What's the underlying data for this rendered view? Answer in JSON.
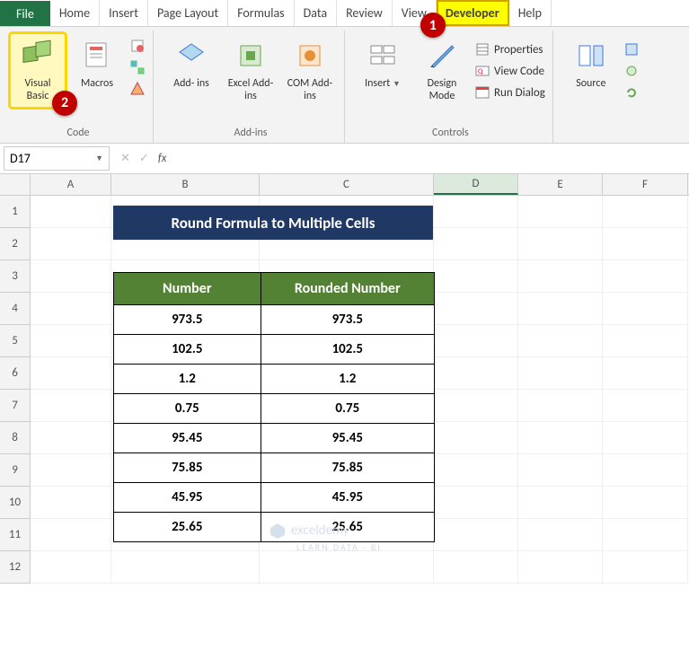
{
  "menu": {
    "file": "File",
    "tabs": [
      "Home",
      "Insert",
      "Page Layout",
      "Formulas",
      "Data",
      "Review",
      "View",
      "Developer",
      "Help"
    ]
  },
  "callouts": {
    "one": "1",
    "two": "2"
  },
  "ribbon": {
    "groups": {
      "code": {
        "label": "Code",
        "visual_basic": "Visual\nBasic",
        "macros": "Macros"
      },
      "addins": {
        "label": "Add-ins",
        "addins": "Add-\nins",
        "excel_addins": "Excel\nAdd-ins",
        "com_addins": "COM\nAdd-ins"
      },
      "controls": {
        "label": "Controls",
        "insert": "Insert",
        "design_mode": "Design\nMode",
        "properties": "Properties",
        "view_code": "View Code",
        "run_dialog": "Run Dialog"
      },
      "xml": {
        "source": "Source"
      }
    }
  },
  "formula_bar": {
    "name_box": "D17",
    "cancel": "✕",
    "confirm": "✓",
    "fx": "fx",
    "value": ""
  },
  "sheet": {
    "columns": [
      "A",
      "B",
      "C",
      "D",
      "E",
      "F"
    ],
    "rows": [
      "1",
      "2",
      "3",
      "4",
      "5",
      "6",
      "7",
      "8",
      "9",
      "10",
      "11",
      "12"
    ],
    "title": "Round Formula to Multiple Cells",
    "headers": {
      "number": "Number",
      "rounded": "Rounded Number"
    },
    "data": [
      {
        "n": "973.5",
        "r": "973.5"
      },
      {
        "n": "102.5",
        "r": "102.5"
      },
      {
        "n": "1.2",
        "r": "1.2"
      },
      {
        "n": "0.75",
        "r": "0.75"
      },
      {
        "n": "95.45",
        "r": "95.45"
      },
      {
        "n": "75.85",
        "r": "75.85"
      },
      {
        "n": "45.95",
        "r": "45.95"
      },
      {
        "n": "25.65",
        "r": "25.65"
      }
    ]
  },
  "watermark": {
    "text": "exceldemy",
    "sub": "LEARN DATA · BI"
  }
}
